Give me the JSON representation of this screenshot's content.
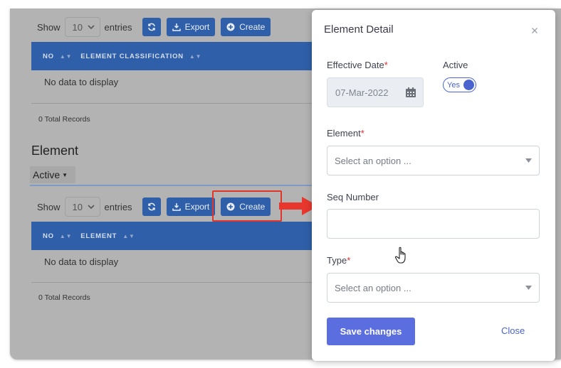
{
  "table_controls": {
    "show_label": "Show",
    "entries_value": "10",
    "entries_label": "entries",
    "export_label": "Export",
    "create_label": "Create"
  },
  "classification_table": {
    "columns": [
      "NO",
      "ELEMENT CLASSIFICATION"
    ],
    "empty_text": "No data to display",
    "total_text": "0 Total Records"
  },
  "element_section": {
    "title": "Element",
    "status_filter": "Active"
  },
  "element_table": {
    "columns": [
      "NO",
      "ELEMENT"
    ],
    "empty_text": "No data to display",
    "total_text": "0 Total Records"
  },
  "modal": {
    "title": "Element Detail",
    "effective_date_label": "Effective Date",
    "effective_date_value": "07-Mar-2022",
    "active_label": "Active",
    "active_toggle_text": "Yes",
    "element_label": "Element",
    "element_placeholder": "Select an option ...",
    "seq_number_label": "Seq Number",
    "seq_number_value": "",
    "type_label": "Type",
    "type_placeholder": "Select an option ...",
    "required_mark": "*",
    "save_label": "Save changes",
    "close_label": "Close"
  },
  "colors": {
    "table_header": "#2f5fa8",
    "primary_button": "#5b6ee0",
    "required": "#e02b2b",
    "callout": "#e0352b"
  }
}
